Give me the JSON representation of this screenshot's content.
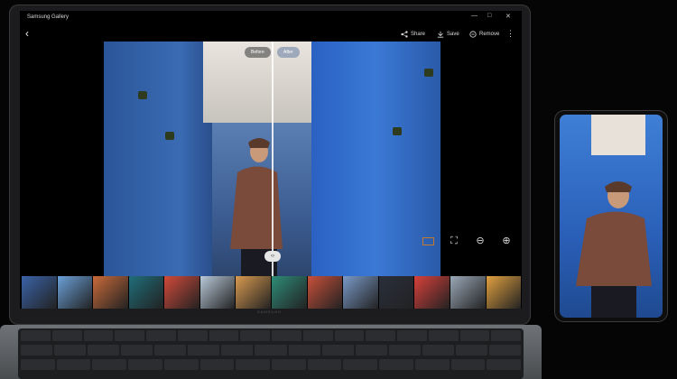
{
  "app": {
    "window_title": "Samsung Gallery"
  },
  "toolbar": {
    "share_label": "Share",
    "save_label": "Save",
    "remove_label": "Remove",
    "more_icon": "more-vertical-icon",
    "back_icon": "back-arrow-icon"
  },
  "compare": {
    "before_label": "Before",
    "after_label": "After",
    "handle_glyph": "‹›"
  },
  "view_controls": [
    "crop-icon",
    "fit-screen-icon",
    "zoom-out-icon",
    "zoom-in-icon"
  ],
  "filmstrip": {
    "thumbnails": [
      {
        "color": "#3a63a8"
      },
      {
        "color": "#6aa0d8"
      },
      {
        "color": "#c96a3a"
      },
      {
        "color": "#1f6e7a"
      },
      {
        "color": "#d24a3a"
      },
      {
        "color": "#b9c9d9"
      },
      {
        "color": "#d89a50"
      },
      {
        "color": "#2e8c78"
      },
      {
        "color": "#c8503a"
      },
      {
        "color": "#7a9ac8"
      },
      {
        "color": "#2a2f3c"
      },
      {
        "color": "#d8403a"
      },
      {
        "color": "#9aa8b8"
      },
      {
        "color": "#e0a040"
      }
    ]
  },
  "laptop": {
    "brand": "SAMSUNG"
  },
  "colors": {
    "accent_crop": "#c7792b",
    "before_tint": "#2f5fa3",
    "after_tint": "#2f6fd0"
  }
}
